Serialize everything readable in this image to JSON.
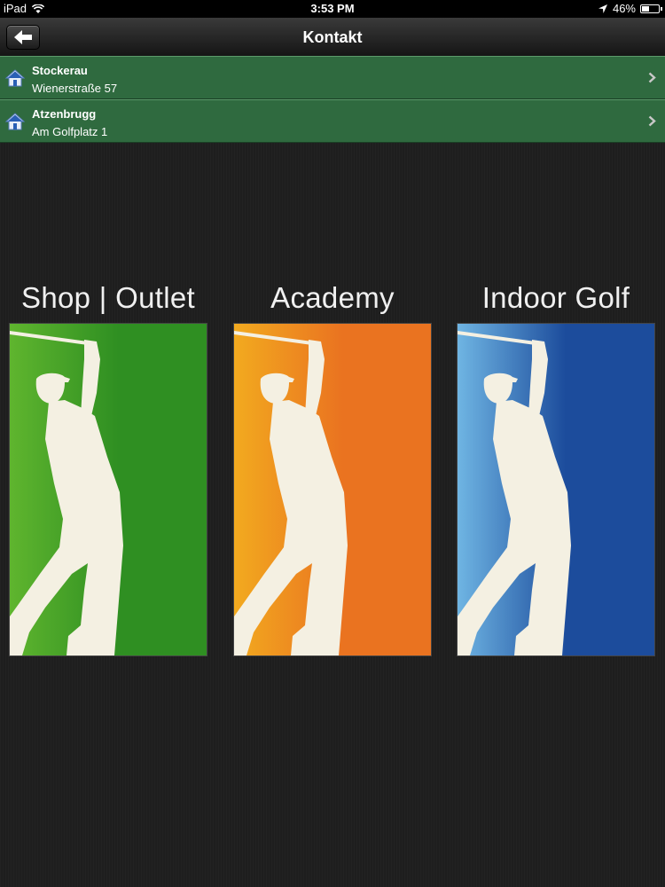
{
  "status_bar": {
    "device": "iPad",
    "time": "3:53 PM",
    "battery": "46%",
    "battery_level": 0.46
  },
  "nav": {
    "title": "Kontakt"
  },
  "locations": [
    {
      "name": "Stockerau",
      "address": "Wienerstraße 57"
    },
    {
      "name": "Atzenbrugg",
      "address": "Am Golfplatz 1"
    }
  ],
  "brands": [
    {
      "title": "Shop | Outlet",
      "color_light": "#5fb52e",
      "color_dark": "#2f8f22"
    },
    {
      "title": "Academy",
      "color_light": "#f2aa1f",
      "color_dark": "#ea7320"
    },
    {
      "title": "Indoor Golf",
      "color_light": "#6fb5e3",
      "color_dark": "#1c4c9c"
    }
  ],
  "colors": {
    "row_green": "#2f6a3f",
    "background": "#1e1e1e"
  }
}
